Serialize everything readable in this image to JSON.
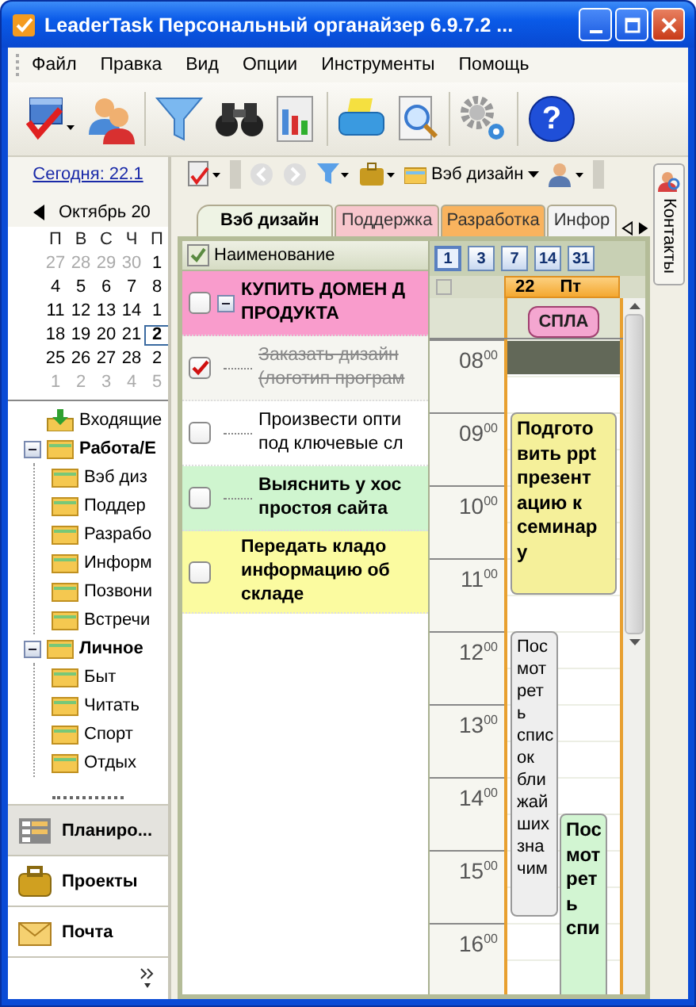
{
  "window": {
    "title": "LeaderTask Персональный органайзер 6.9.7.2 ..."
  },
  "toolbar": {
    "help": "?"
  },
  "menu": [
    "Файл",
    "Правка",
    "Вид",
    "Опции",
    "Инструменты",
    "Помощь"
  ],
  "sidebar": {
    "today": "Сегодня: 22.1",
    "calendar": {
      "month": "Октябрь 20",
      "weekdays": [
        "П",
        "В",
        "С",
        "Ч",
        "П"
      ],
      "weeks": [
        [
          {
            "day": "27",
            "other_month": true,
            "selected": false
          },
          {
            "day": "28",
            "other_month": true,
            "selected": false
          },
          {
            "day": "29",
            "other_month": true,
            "selected": false
          },
          {
            "day": "30",
            "other_month": true,
            "selected": false
          },
          {
            "day": "1",
            "other_month": false,
            "selected": false
          }
        ],
        [
          {
            "day": "4",
            "other_month": false,
            "selected": false
          },
          {
            "day": "5",
            "other_month": false,
            "selected": false
          },
          {
            "day": "6",
            "other_month": false,
            "selected": false
          },
          {
            "day": "7",
            "other_month": false,
            "selected": false
          },
          {
            "day": "8",
            "other_month": false,
            "selected": false
          }
        ],
        [
          {
            "day": "11",
            "other_month": false,
            "selected": false
          },
          {
            "day": "12",
            "other_month": false,
            "selected": false
          },
          {
            "day": "13",
            "other_month": false,
            "selected": false
          },
          {
            "day": "14",
            "other_month": false,
            "selected": false
          },
          {
            "day": "1",
            "other_month": false,
            "selected": false
          }
        ],
        [
          {
            "day": "18",
            "other_month": false,
            "selected": false
          },
          {
            "day": "19",
            "other_month": false,
            "selected": false
          },
          {
            "day": "20",
            "other_month": false,
            "selected": false
          },
          {
            "day": "21",
            "other_month": false,
            "selected": false
          },
          {
            "day": "2",
            "other_month": false,
            "selected": true
          }
        ],
        [
          {
            "day": "25",
            "other_month": false,
            "selected": false
          },
          {
            "day": "26",
            "other_month": false,
            "selected": false
          },
          {
            "day": "27",
            "other_month": false,
            "selected": false
          },
          {
            "day": "28",
            "other_month": false,
            "selected": false
          },
          {
            "day": "2",
            "other_month": false,
            "selected": false
          }
        ],
        [
          {
            "day": "1",
            "other_month": true,
            "selected": false
          },
          {
            "day": "2",
            "other_month": true,
            "selected": false
          },
          {
            "day": "3",
            "other_month": true,
            "selected": false
          },
          {
            "day": "4",
            "other_month": true,
            "selected": false
          },
          {
            "day": "5",
            "other_month": true,
            "selected": false
          }
        ]
      ]
    },
    "tree": [
      {
        "label": "Входящие",
        "kind": "inbox",
        "bold": false
      },
      {
        "label": "Работа/Е",
        "kind": "folder",
        "bold": true,
        "expanded": true,
        "children": [
          {
            "label": "Вэб диз",
            "kind": "folder",
            "bold": false
          },
          {
            "label": "Поддер",
            "kind": "folder",
            "bold": false
          },
          {
            "label": "Разрабо",
            "kind": "folder",
            "bold": false
          },
          {
            "label": "Информ",
            "kind": "folder",
            "bold": false
          },
          {
            "label": "Позвони",
            "kind": "folder",
            "bold": false
          },
          {
            "label": "Встречи",
            "kind": "folder",
            "bold": false
          }
        ]
      },
      {
        "label": "Личное",
        "kind": "folder",
        "bold": true,
        "expanded": true,
        "children": [
          {
            "label": "Быт",
            "kind": "folder",
            "bold": false
          },
          {
            "label": "Читать",
            "kind": "folder",
            "bold": false
          },
          {
            "label": "Спорт",
            "kind": "folder",
            "bold": false
          },
          {
            "label": "Отдых",
            "kind": "folder",
            "bold": false
          }
        ]
      }
    ],
    "nav": [
      {
        "label": "Планиро...",
        "kind": "planner",
        "selected": true
      },
      {
        "label": "Проекты",
        "kind": "projects",
        "selected": false
      },
      {
        "label": "Почта",
        "kind": "mail",
        "selected": false
      }
    ]
  },
  "subtoolbar": {
    "project": "Вэб дизайн"
  },
  "tabs": [
    {
      "label": "Вэб дизайн",
      "selected": true,
      "color": "#eef3e4"
    },
    {
      "label": "Поддержка",
      "selected": false,
      "color": "#f7c6cc"
    },
    {
      "label": "Разработка",
      "selected": false,
      "color": "#f9b35e"
    },
    {
      "label": "Инфор",
      "selected": false,
      "color": "#f4f4f4"
    }
  ],
  "tasks": {
    "column": "Наименование",
    "rows": [
      {
        "text": "КУПИТЬ ДОМЕН Д\nПРОДУКТА",
        "checked": false,
        "done": false,
        "bold": true,
        "color": "#f99ccc",
        "expanded": true,
        "children": [
          {
            "text": "Заказать дизайн\n(логотип програм",
            "checked": true,
            "done": true,
            "bold": false,
            "color": "#f5f5f0"
          },
          {
            "text": "Произвести опти\nпод ключевые сл",
            "checked": false,
            "done": false,
            "bold": false,
            "color": "#ffffff"
          },
          {
            "text": "Выяснить у хос\nпростоя сайта",
            "checked": false,
            "done": false,
            "bold": true,
            "color": "#cff5cf"
          }
        ]
      },
      {
        "text": "Передать кладо\nинформацию об\nскладе",
        "checked": false,
        "done": false,
        "bold": true,
        "color": "#fbfba0"
      }
    ]
  },
  "calendar_view": {
    "scales": [
      {
        "label": "1",
        "selected": true
      },
      {
        "label": "3",
        "selected": false
      },
      {
        "label": "7",
        "selected": false
      },
      {
        "label": "14",
        "selected": false
      },
      {
        "label": "31",
        "selected": false
      }
    ],
    "day": {
      "date": "22",
      "weekday": "Пт"
    },
    "all_day": [
      {
        "text": "СПЛА",
        "color": "#f4a6d0"
      }
    ],
    "hours": [
      "08$^{00}$",
      "09$^{00}$",
      "10$^{00}$",
      "11$^{00}$",
      "12$^{00}$",
      "13$^{00}$",
      "14$^{00}$",
      "15$^{00}$",
      "16$^{00}$"
    ],
    "events": [
      {
        "text": "Подгото\nвить ppt\nпрезент\nацию к\nсеминар\nу",
        "color": "#f5f09a",
        "bold": true
      },
      {
        "text": "Пос\nмот\nрет\nь\nспис\nок\nбли\nжай\nших\nзна\nчим",
        "color": "#eeeeee",
        "bold": false
      },
      {
        "text": "Пос\nмот\nрет\nь\nспи",
        "color": "#d2f5d2",
        "bold": true
      }
    ]
  },
  "side_tab": "Контакты"
}
